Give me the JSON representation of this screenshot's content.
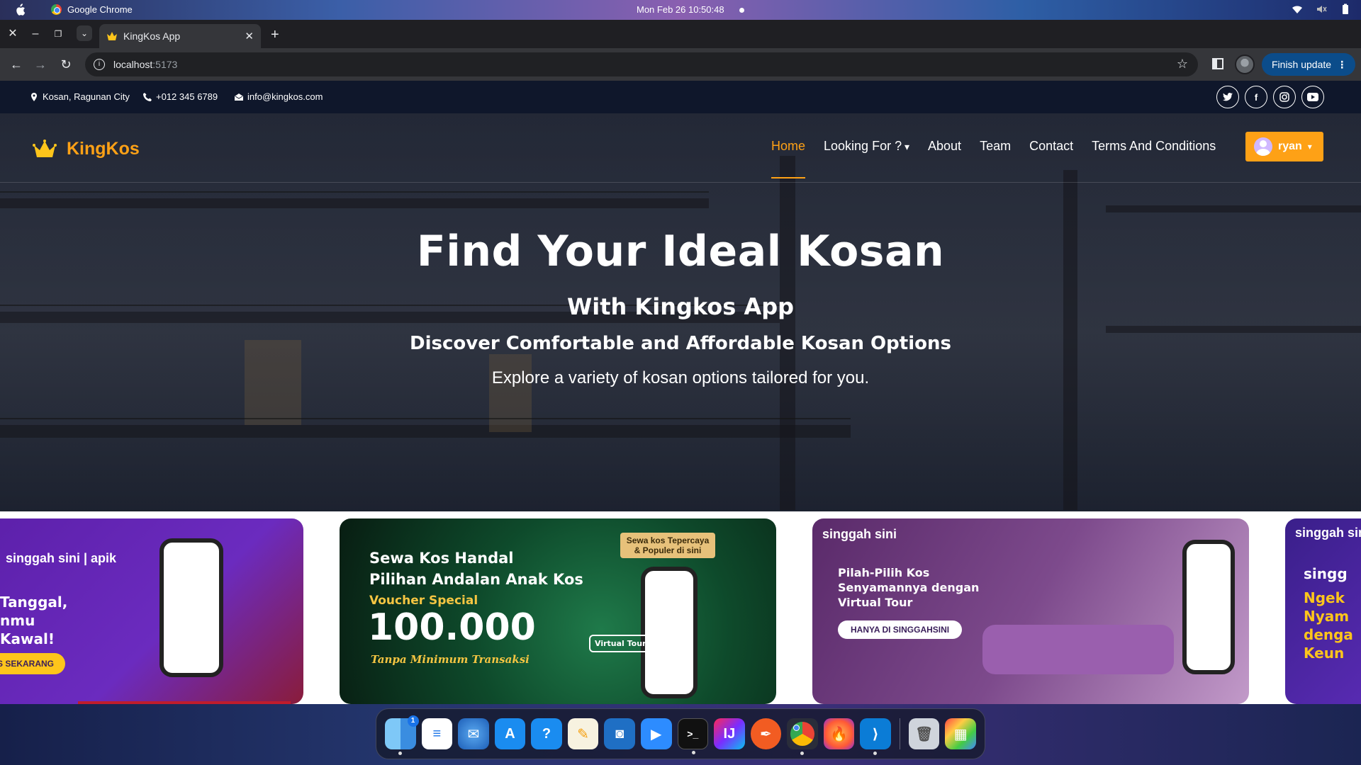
{
  "os": {
    "app_name": "Google Chrome",
    "clock": "Mon Feb 26  10:50:48"
  },
  "browser": {
    "tab_title": "KingKos App",
    "url_host": "localhost",
    "url_port": ":5173",
    "finish_update": "Finish update"
  },
  "topbar": {
    "address": "Kosan, Ragunan City",
    "phone": "+012 345 6789",
    "email": "info@kingkos.com",
    "socials": [
      "twitter",
      "facebook",
      "instagram",
      "youtube"
    ]
  },
  "navbar": {
    "brand": "KingKos",
    "links": [
      "Home",
      "Looking For ?",
      "About",
      "Team",
      "Contact",
      "Terms And Conditions"
    ],
    "active": "Home",
    "user": "ryan"
  },
  "hero": {
    "title": "Find Your Ideal Kosan",
    "subtitle": "With Kingkos App",
    "tagline": "Discover Comfortable and Affordable Kosan Options",
    "description": "Explore a variety of kosan options tailored for you."
  },
  "carousel": {
    "slide1": {
      "brand": "singgah sini | apik",
      "lines": [
        "Tanggal,",
        "nmu",
        "Kawal!"
      ],
      "cta": "S SEKARANG"
    },
    "slide2": {
      "headline1": "Sewa Kos Handal",
      "headline2": "Pilihan Andalan Anak Kos",
      "voucher_label": "Voucher Special",
      "amount": "100.000",
      "note": "Tanpa Minimum Transaksi",
      "badge": "Sewa kos Tepercaya & Populer di sini",
      "tour": "Virtual Tour"
    },
    "slide3": {
      "brand": "singgah sini",
      "headline": "Pilah-Pilih Kos Senyamannya dengan Virtual Tour",
      "cta": "HANYA DI SINGGAHSINI"
    },
    "slide4": {
      "brand": "singgah sini",
      "lines": [
        "singg",
        "Ngek",
        "Nyam",
        "denga",
        "Keun"
      ]
    }
  },
  "colors": {
    "accent": "#fea116",
    "dark": "#0f172b"
  },
  "dock": [
    "finder",
    "text-editor",
    "thunderbird",
    "app-store",
    "help",
    "notes",
    "remote",
    "zoom",
    "terminal",
    "intellij",
    "pen-tool",
    "chrome",
    "firefox",
    "vscode",
    "trash",
    "launchpad"
  ]
}
